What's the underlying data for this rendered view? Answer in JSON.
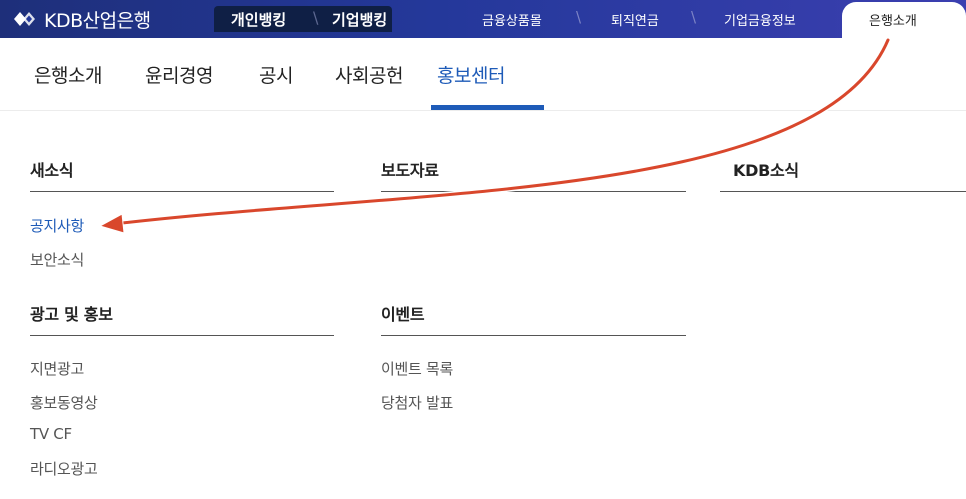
{
  "header": {
    "logo_text": "KDB산업은행",
    "tabs": [
      {
        "label": "개인뱅킹"
      },
      {
        "label": "기업뱅킹"
      }
    ],
    "links": [
      {
        "label": "금융상품몰"
      },
      {
        "label": "퇴직연금"
      },
      {
        "label": "기업금융정보"
      }
    ],
    "active_tab": "은행소개"
  },
  "subnav": {
    "items": [
      {
        "label": "은행소개"
      },
      {
        "label": "윤리경영"
      },
      {
        "label": "공시"
      },
      {
        "label": "사회공헌"
      },
      {
        "label": "홍보센터"
      }
    ],
    "active": "홍보센터"
  },
  "sections": [
    {
      "title": "새소식",
      "links": [
        "공지사항",
        "보안소식"
      ]
    },
    {
      "title": "보도자료",
      "links": []
    },
    {
      "title": "KDB소식",
      "links": []
    },
    {
      "title": "광고 및 홍보",
      "links": [
        "지면광고",
        "홍보동영상",
        "TV CF",
        "라디오광고"
      ]
    },
    {
      "title": "이벤트",
      "links": [
        "이벤트 목록",
        "당첨자 발표"
      ]
    }
  ],
  "colors": {
    "brand_navy": "#24389a",
    "pill_dark": "#0f1f45",
    "accent_blue": "#1e5bb8",
    "annotation_arrow": "#d9472c"
  }
}
